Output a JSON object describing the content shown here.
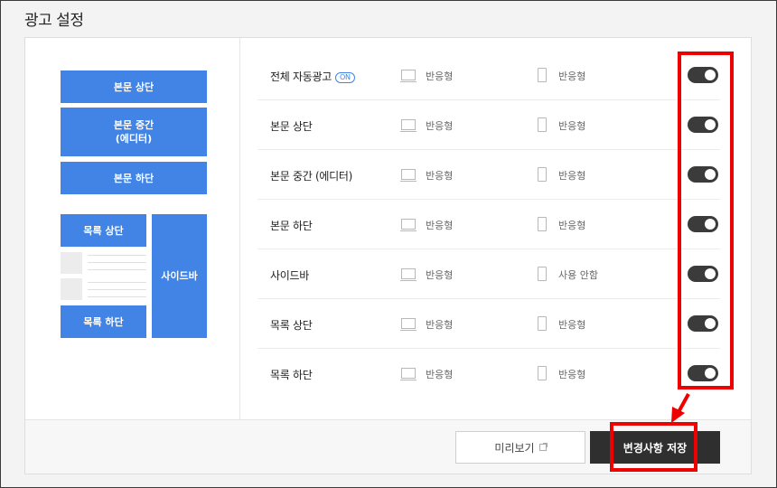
{
  "page": {
    "title": "광고 설정"
  },
  "layout_preview": {
    "body_top": "본문 상단",
    "body_middle": "본문 중간\n(에디터)",
    "body_bottom": "본문 하단",
    "list_top": "목록 상단",
    "list_bottom": "목록 하단",
    "sidebar": "사이드바"
  },
  "settings": {
    "on_badge": "ON",
    "rows": [
      {
        "label": "전체 자동광고",
        "pc": "반응형",
        "mobile": "반응형",
        "enabled": true
      },
      {
        "label": "본문 상단",
        "pc": "반응형",
        "mobile": "반응형",
        "enabled": true
      },
      {
        "label": "본문 중간 (에디터)",
        "pc": "반응형",
        "mobile": "반응형",
        "enabled": true
      },
      {
        "label": "본문 하단",
        "pc": "반응형",
        "mobile": "반응형",
        "enabled": true
      },
      {
        "label": "사이드바",
        "pc": "반응형",
        "mobile": "사용 안함",
        "enabled": true
      },
      {
        "label": "목록 상단",
        "pc": "반응형",
        "mobile": "반응형",
        "enabled": true
      },
      {
        "label": "목록 하단",
        "pc": "반응형",
        "mobile": "반응형",
        "enabled": true
      }
    ]
  },
  "footer": {
    "preview_label": "미리보기",
    "save_label": "변경사항 저장"
  },
  "colors": {
    "accent_blue": "#4184e6",
    "toggle_on": "#3b3b3b",
    "highlight_red": "#ee0000",
    "save_button": "#2f2f2f"
  }
}
